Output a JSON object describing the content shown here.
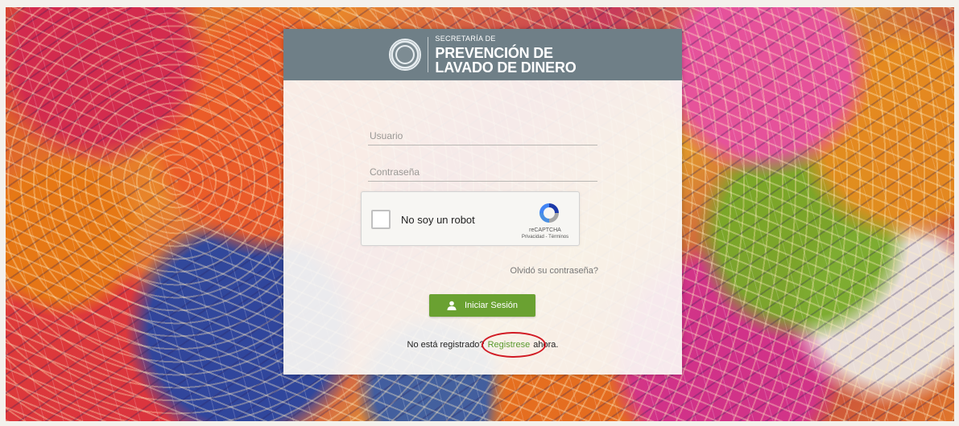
{
  "header": {
    "subtitle": "SECRETARÍA DE",
    "title_line1": "PREVENCIÓN DE",
    "title_line2": "LAVADO DE DINERO"
  },
  "form": {
    "username_placeholder": "Usuario",
    "password_placeholder": "Contraseña",
    "forgot_link": "Olvidó su contraseña?",
    "login_button": "Iniciar Sesión",
    "register_prefix": "No está registrado?",
    "register_link": "Registrese",
    "register_suffix": "ahora."
  },
  "captcha": {
    "label": "No soy un robot",
    "brand": "reCAPTCHA",
    "privacy": "Privacidad",
    "terms_sep": " - ",
    "terms": "Términos"
  },
  "colors": {
    "header_bg": "#6f7f87",
    "button_bg": "#6aa131",
    "link": "#5a9a2e",
    "annotation_circle": "#d11b24"
  },
  "icons": {
    "seal": "government-seal-icon",
    "login": "user-icon",
    "captcha": "recaptcha-logo-icon"
  }
}
